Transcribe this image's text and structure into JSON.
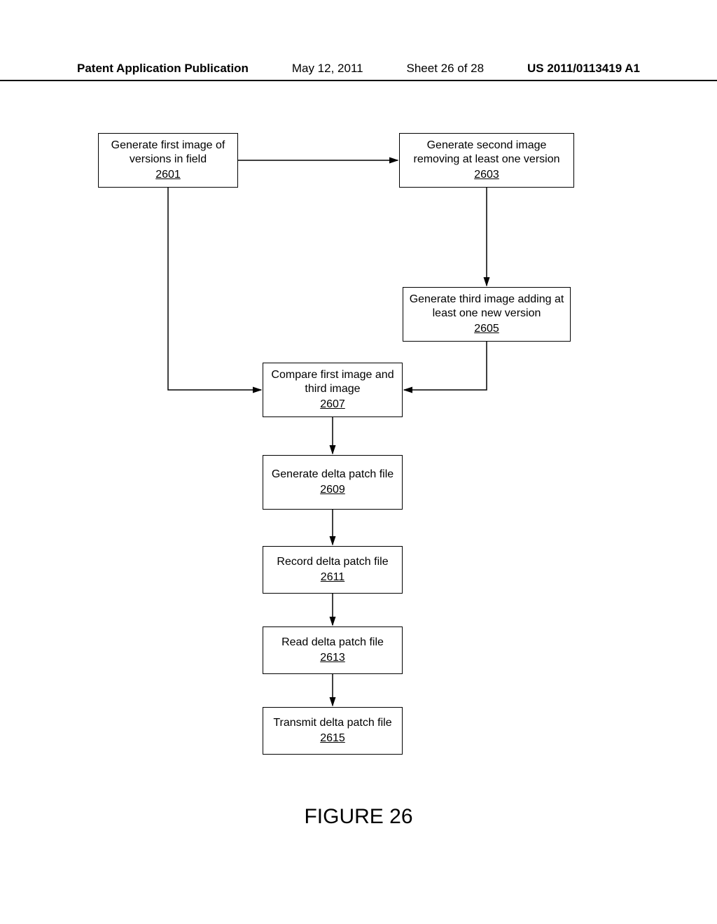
{
  "header": {
    "publication": "Patent Application Publication",
    "date": "May 12, 2011",
    "sheet": "Sheet 26 of 28",
    "pubno": "US 2011/0113419 A1"
  },
  "boxes": {
    "b2601": {
      "text": "Generate first image of versions in field",
      "ref": "2601"
    },
    "b2603": {
      "text": "Generate second image removing at least one version",
      "ref": "2603"
    },
    "b2605": {
      "text": "Generate third image adding at least one new version",
      "ref": "2605"
    },
    "b2607": {
      "text": "Compare first image and third image",
      "ref": "2607"
    },
    "b2609": {
      "text": "Generate delta patch file",
      "ref": "2609"
    },
    "b2611": {
      "text": "Record delta patch file",
      "ref": "2611"
    },
    "b2613": {
      "text": "Read delta patch file",
      "ref": "2613"
    },
    "b2615": {
      "text": "Transmit delta patch file",
      "ref": "2615"
    }
  },
  "figure_label": "FIGURE 26",
  "chart_data": {
    "type": "flowchart",
    "nodes": [
      {
        "id": "2601",
        "label": "Generate first image of versions in field"
      },
      {
        "id": "2603",
        "label": "Generate second image removing at least one version"
      },
      {
        "id": "2605",
        "label": "Generate third image adding at least one new version"
      },
      {
        "id": "2607",
        "label": "Compare first image and third image"
      },
      {
        "id": "2609",
        "label": "Generate delta patch file"
      },
      {
        "id": "2611",
        "label": "Record delta patch file"
      },
      {
        "id": "2613",
        "label": "Read delta patch file"
      },
      {
        "id": "2615",
        "label": "Transmit delta patch file"
      }
    ],
    "edges": [
      {
        "from": "2601",
        "to": "2603"
      },
      {
        "from": "2603",
        "to": "2605"
      },
      {
        "from": "2601",
        "to": "2607"
      },
      {
        "from": "2605",
        "to": "2607"
      },
      {
        "from": "2607",
        "to": "2609"
      },
      {
        "from": "2609",
        "to": "2611"
      },
      {
        "from": "2611",
        "to": "2613"
      },
      {
        "from": "2613",
        "to": "2615"
      }
    ]
  }
}
